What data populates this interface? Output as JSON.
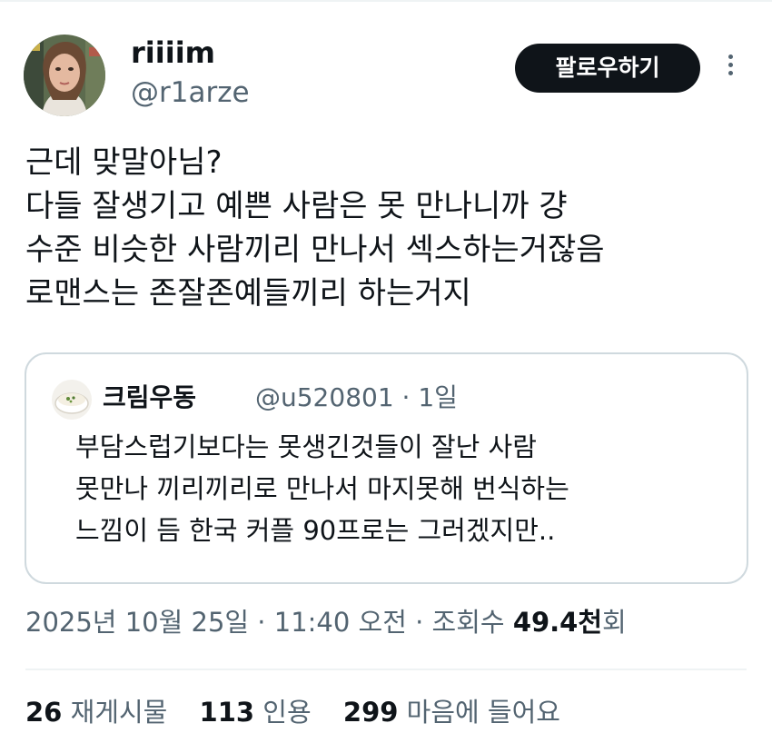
{
  "author": {
    "display_name": "riiiim",
    "handle": "@r1arze"
  },
  "follow_button_label": "팔로우하기",
  "tweet_lines": [
    "근데 맞말아님?",
    "다들 잘생기고 예쁜 사람은 못 만나니까 걍",
    "수준 비슷한 사람끼리 만나서 섹스하는거잖음",
    "로맨스는 존잘존예들끼리 하는거지"
  ],
  "quote": {
    "display_name": "크림우동",
    "handle": "@u520801",
    "separator": "·",
    "age": "1일",
    "lines": [
      "부담스럽기보다는 못생긴것들이 잘난 사람",
      "못만나 끼리끼리로 만나서 마지못해 번식하는",
      "느낌이 듬 한국 커플 90프로는 그러겠지만.."
    ]
  },
  "meta": {
    "timestamp": "2025년 10월 25일 · 11:40 오전 · 조회수 ",
    "views_count": "49.4천",
    "views_suffix": "회"
  },
  "stats": {
    "reposts_count": "26",
    "reposts_label": "재게시물",
    "quotes_count": "113",
    "quotes_label": "인용",
    "likes_count": "299",
    "likes_label": "마음에 들어요"
  },
  "colors": {
    "text_primary": "#0f1419",
    "text_secondary": "#536471",
    "border": "#cfd9de",
    "follow_bg": "#0f1419",
    "follow_text": "#ffffff"
  }
}
